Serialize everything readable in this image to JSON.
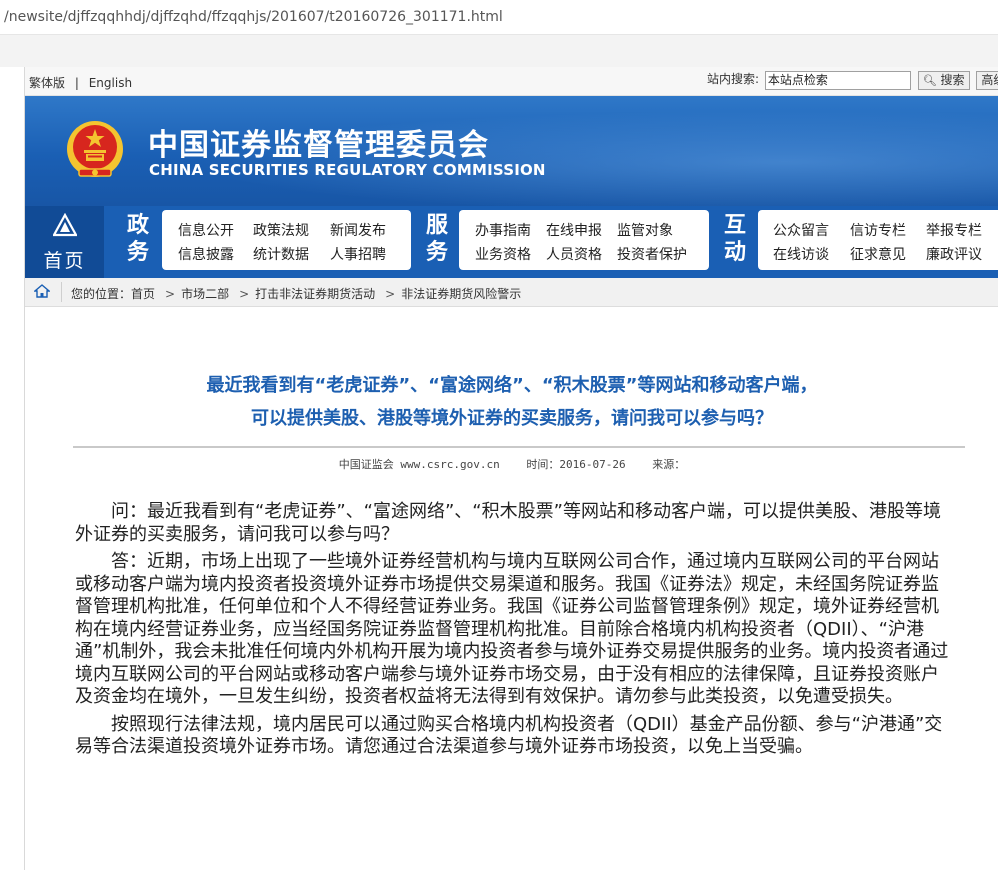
{
  "browser": {
    "url": "/newsite/djffzqqhhdj/djffzqhd/ffzqqhjs/201607/t20160726_301171.html"
  },
  "topbar": {
    "lang_trad": "繁体版",
    "lang_sep": "|",
    "lang_en": "English",
    "search_label": "站内搜索:",
    "search_value": "本站点检索",
    "search_button": "搜索",
    "advanced_button": "高级"
  },
  "banner": {
    "title_cn": "中国证券监督管理委员会",
    "title_en": "CHINA SECURITIES REGULATORY COMMISSION"
  },
  "nav": {
    "home": "首页",
    "groups": [
      {
        "label": [
          "政",
          "务"
        ],
        "items": [
          "信息公开",
          "政策法规",
          "新闻发布",
          "信息披露",
          "统计数据",
          "人事招聘"
        ]
      },
      {
        "label": [
          "服",
          "务"
        ],
        "items": [
          "办事指南",
          "在线申报",
          "监管对象",
          "业务资格",
          "人员资格",
          "投资者保护"
        ]
      },
      {
        "label": [
          "互",
          "动"
        ],
        "items": [
          "公众留言",
          "信访专栏",
          "举报专栏",
          "在线访谈",
          "征求意见",
          "廉政评议"
        ]
      }
    ]
  },
  "breadcrumb": {
    "prefix": "您的位置：首页",
    "items": [
      "市场二部",
      "打击非法证券期货活动",
      "非法证券期货风险警示"
    ],
    "sep": ">"
  },
  "article": {
    "title_line1": "最近我看到有“老虎证券”、“富途网络”、“积木股票”等网站和移动客户端，",
    "title_line2": "可以提供美股、港股等境外证券的买卖服务，请问我可以参与吗？",
    "source": "中国证监会 www.csrc.gov.cn",
    "time": "时间：2016-07-26",
    "origin": "来源：",
    "paragraphs": [
      "问：最近我看到有“老虎证券”、“富途网络”、“积木股票”等网站和移动客户端，可以提供美股、港股等境外证券的买卖服务，请问我可以参与吗？",
      "答：近期，市场上出现了一些境外证券经营机构与境内互联网公司合作，通过境内互联网公司的平台网站或移动客户端为境内投资者投资境外证券市场提供交易渠道和服务。我国《证券法》规定，未经国务院证券监督管理机构批准，任何单位和个人不得经营证券业务。我国《证券公司监督管理条例》规定，境外证券经营机构在境内经营证券业务，应当经国务院证券监督管理机构批准。目前除合格境内机构投资者（QDII）、“沪港通”机制外，我会未批准任何境内外机构开展为境内投资者参与境外证券交易提供服务的业务。境内投资者通过境内互联网公司的平台网站或移动客户端参与境外证券市场交易，由于没有相应的法律保障，且证券投资账户及资金均在境外，一旦发生纠纷，投资者权益将无法得到有效保护。请勿参与此类投资，以免遭受损失。",
      "按照现行法律法规，境内居民可以通过购买合格境内机构投资者（QDII）基金产品份额、参与“沪港通”交易等合法渠道投资境外证券市场。请您通过合法渠道参与境外证券市场投资，以免上当受骗。"
    ]
  },
  "colors": {
    "brand_blue": "#1a5fb4",
    "title_blue": "#1d5fb0",
    "nav_dark": "#114b96",
    "emblem_red": "#d7261e",
    "emblem_gold": "#f4c430"
  }
}
